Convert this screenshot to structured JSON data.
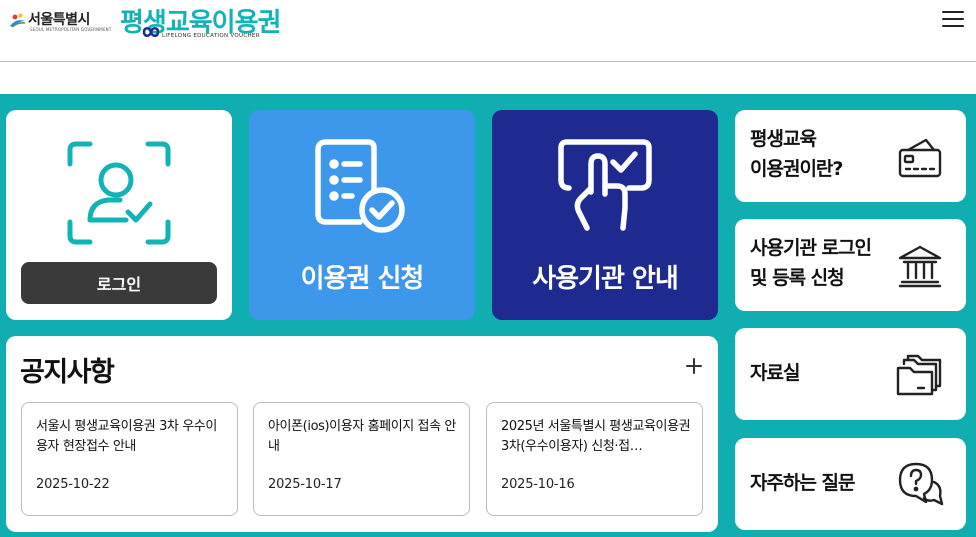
{
  "header": {
    "seoul_logo_text": "서울특별시",
    "seoul_logo_sub": "SEOUL METROPOLITAN GOVERNMENT",
    "brand_title": "평생교육이용권",
    "brand_sub": "LIFELONG EDUCATION VOUCHER",
    "menu_icon": "hamburger-icon"
  },
  "tiles": {
    "login": {
      "icon": "face-scan-user-icon",
      "button_label": "로그인"
    },
    "apply": {
      "icon": "checklist-check-icon",
      "label": "이용권 신청"
    },
    "institution": {
      "icon": "hand-touch-check-icon",
      "label": "사용기관 안내"
    }
  },
  "notice": {
    "title": "공지사항",
    "more_icon": "plus-icon",
    "items": [
      {
        "title": "서울시 평생교육이용권 3차 우수이용자 현장접수 안내",
        "date": "2025-10-22"
      },
      {
        "title": "아이폰(ios)이용자 홈페이지 접속 안내",
        "date": "2025-10-17"
      },
      {
        "title": "2025년 서울특별시 평생교육이용권 3차(우수이용자) 신청·접…",
        "date": "2025-10-16"
      }
    ]
  },
  "side": [
    {
      "label": "평생교육\n이용권이란?",
      "icon": "card-icon"
    },
    {
      "label": "사용기관 로그인\n및 등록 신청",
      "icon": "bank-icon"
    },
    {
      "label": "자료실",
      "icon": "folders-icon"
    },
    {
      "label": "자주하는 질문",
      "icon": "question-chat-icon"
    }
  ],
  "colors": {
    "teal": "#11aeb1",
    "apply_blue": "#3d98ec",
    "navy": "#1f2a91",
    "dark_button": "#3a3a3a",
    "brand_teal": "#12b3b4"
  }
}
